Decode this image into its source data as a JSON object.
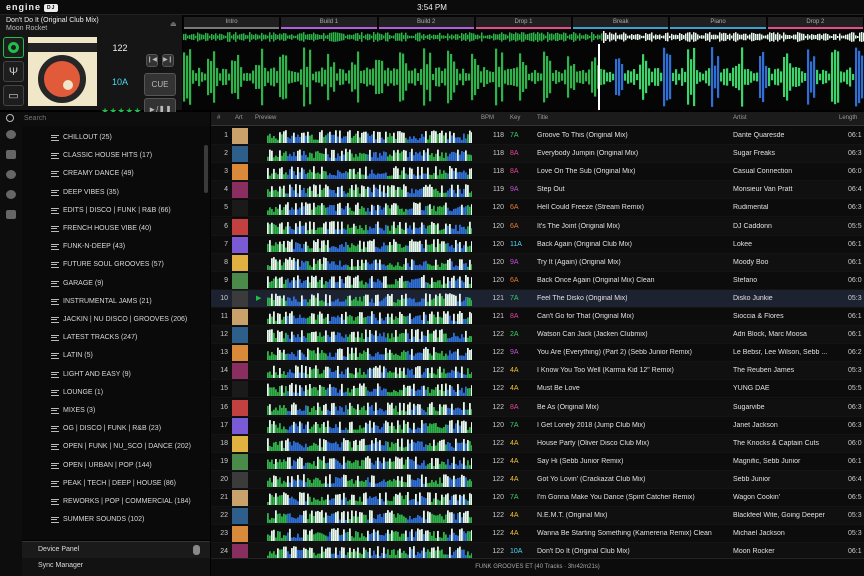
{
  "app": {
    "logo": "engine",
    "badge": "DJ",
    "clock": "3:54 PM"
  },
  "deck": {
    "title": "Don't Do It (Original Club Mix)",
    "artist": "Moon Rocket",
    "bpm": "122",
    "key": "10A",
    "rating_stars": 5,
    "cue_label": "CUE",
    "play_label": "►/❚❚",
    "eject_icon": "eject-icon",
    "accent": "#1fbf4a"
  },
  "sections": [
    "Intro",
    "Build 1",
    "Build 2",
    "Drop 1",
    "Break",
    "Piano",
    "Drop 2"
  ],
  "search": {
    "placeholder": "Search"
  },
  "crates": [
    "CHILLOUT (25)",
    "CLASSIC HOUSE HITS (17)",
    "CREAMY DANCE (49)",
    "DEEP VIBES (35)",
    "EDITS | DISCO | FUNK | R&B (66)",
    "FRENCH HOUSE VIBE (40)",
    "FUNK-N-DEEP (43)",
    "FUTURE SOUL GROOVES (57)",
    "GARAGE (9)",
    "INSTRUMENTAL JAMS (21)",
    "JACKIN | NU DISCO | GROOVES (206)",
    "LATEST TRACKS (247)",
    "LATIN (5)",
    "LIGHT AND EASY (9)",
    "LOUNGE (1)",
    "MIXES (3)",
    "OG | DISCO | FUNK | R&B (23)",
    "OPEN | FUNK | NU_SCO | DANCE (202)",
    "OPEN | URBAN | POP (144)",
    "PEAK | TECH | DEEP | HOUSE (86)",
    "REWORKS | POP | COMMERCIAL (184)",
    "SUMMER SOUNDS (102)"
  ],
  "bottom": {
    "device_panel": "Device Panel",
    "sync_manager": "Sync Manager"
  },
  "table": {
    "headers": {
      "num": "#",
      "art": "Art",
      "preview": "Preview",
      "bpm": "BPM",
      "key": "Key",
      "title": "Title",
      "artist": "Artist",
      "length": "Length"
    },
    "selected_row": 10,
    "rows": [
      {
        "n": "1",
        "bpm": "118",
        "key": "7A",
        "kc": "#3ad06c",
        "title": "Groove To This (Original Mix)",
        "artist": "Dante Quaresde",
        "len": "06:1"
      },
      {
        "n": "2",
        "bpm": "118",
        "key": "8A",
        "kc": "#e0459b",
        "title": "Everybody Jumpin (Original Mix)",
        "artist": "Sugar Freaks",
        "len": "06:3"
      },
      {
        "n": "3",
        "bpm": "118",
        "key": "8A",
        "kc": "#e0459b",
        "title": "Love On The Sub (Original Mix)",
        "artist": "Casual Connection",
        "len": "06:0"
      },
      {
        "n": "4",
        "bpm": "119",
        "key": "9A",
        "kc": "#c24fd6",
        "title": "Step Out",
        "artist": "Monsieur Van Pratt",
        "len": "06:4"
      },
      {
        "n": "5",
        "bpm": "120",
        "key": "6A",
        "kc": "#e77a2c",
        "title": "Hell Could Freeze (Stream Remix)",
        "artist": "Rudimental",
        "len": "06:3"
      },
      {
        "n": "6",
        "bpm": "120",
        "key": "6A",
        "kc": "#e77a2c",
        "title": "It's The Joint (Original Mix)",
        "artist": "DJ Caddonn",
        "len": "05:5"
      },
      {
        "n": "7",
        "bpm": "120",
        "key": "11A",
        "kc": "#4cd9f2",
        "title": "Back Again (Original Club Mix)",
        "artist": "Lokee",
        "len": "06:1"
      },
      {
        "n": "8",
        "bpm": "120",
        "key": "9A",
        "kc": "#c24fd6",
        "title": "Try It (Again) (Original Mix)",
        "artist": "Moody Boo",
        "len": "06:1"
      },
      {
        "n": "9",
        "bpm": "120",
        "key": "6A",
        "kc": "#e77a2c",
        "title": "Back Once Again (Original Mix) Clean",
        "artist": "Stefano",
        "len": "06:0"
      },
      {
        "n": "10",
        "bpm": "121",
        "key": "7A",
        "kc": "#3ad06c",
        "title": "Feel The Disko (Original Mix)",
        "artist": "Disko Junkie",
        "len": "05:3"
      },
      {
        "n": "11",
        "bpm": "121",
        "key": "8A",
        "kc": "#e0459b",
        "title": "Can't Go for That (Original Mix)",
        "artist": "Sioccia & Flores",
        "len": "06:1"
      },
      {
        "n": "12",
        "bpm": "122",
        "key": "2A",
        "kc": "#3ad06c",
        "title": "Watson Can Jack (Jacken Clubmix)",
        "artist": "Adri Block, Marc Moosa",
        "len": "06:1"
      },
      {
        "n": "13",
        "bpm": "122",
        "key": "9A",
        "kc": "#c24fd6",
        "title": "You Are (Everything) (Part 2) (Sebb Junior Remix)",
        "artist": "Le Bebsr, Lee Wilson, Sebb ...",
        "len": "06:2"
      },
      {
        "n": "14",
        "bpm": "122",
        "key": "4A",
        "kc": "#f2c12e",
        "title": "I Know You Too Well (Karma Kid 12\" Remix)",
        "artist": "The Reuben James",
        "len": "05:3"
      },
      {
        "n": "15",
        "bpm": "122",
        "key": "4A",
        "kc": "#f2c12e",
        "title": "Must Be Love",
        "artist": "YUNG DAE",
        "len": "05:5"
      },
      {
        "n": "16",
        "bpm": "122",
        "key": "8A",
        "kc": "#e0459b",
        "title": "Be As (Original Mix)",
        "artist": "Sugarvibe",
        "len": "06:3"
      },
      {
        "n": "17",
        "bpm": "120",
        "key": "7A",
        "kc": "#3ad06c",
        "title": "I Get Lonely 2018 (Jump Club Mix)",
        "artist": "Janet Jackson",
        "len": "06:3"
      },
      {
        "n": "18",
        "bpm": "122",
        "key": "4A",
        "kc": "#f2c12e",
        "title": "House Party (Oliver Disco Club Mix)",
        "artist": "The Knocks & Captain Cuts",
        "len": "06:0"
      },
      {
        "n": "19",
        "bpm": "122",
        "key": "4A",
        "kc": "#f2c12e",
        "title": "Say Hi (Sebb Junior Remix)",
        "artist": "Magnific, Sebb Junior",
        "len": "06:1"
      },
      {
        "n": "20",
        "bpm": "122",
        "key": "4A",
        "kc": "#f2c12e",
        "title": "Got Yo Lovin' (Crackazat Club Mix)",
        "artist": "Sebb Junior",
        "len": "06:4"
      },
      {
        "n": "21",
        "bpm": "120",
        "key": "7A",
        "kc": "#3ad06c",
        "title": "I'm Gonna Make You Dance (Spirit Catcher Remix)",
        "artist": "Wagon Cookin'",
        "len": "06:5"
      },
      {
        "n": "22",
        "bpm": "122",
        "key": "4A",
        "kc": "#f2c12e",
        "title": "N.E.M.T. (Original Mix)",
        "artist": "Blackfeel Wite, Going Deeper",
        "len": "05:3"
      },
      {
        "n": "23",
        "bpm": "122",
        "key": "4A",
        "kc": "#f2c12e",
        "title": "Wanna Be Starting Something (Kamerena Remix) Clean",
        "artist": "Michael Jackson",
        "len": "05:3"
      },
      {
        "n": "24",
        "bpm": "122",
        "key": "10A",
        "kc": "#4cd9f2",
        "title": "Don't Do It (Original Club Mix)",
        "artist": "Moon Rocker",
        "len": "06:1"
      }
    ]
  },
  "status": "FUNK GROOVES ET (40 Tracks · 3hr42m21s)"
}
